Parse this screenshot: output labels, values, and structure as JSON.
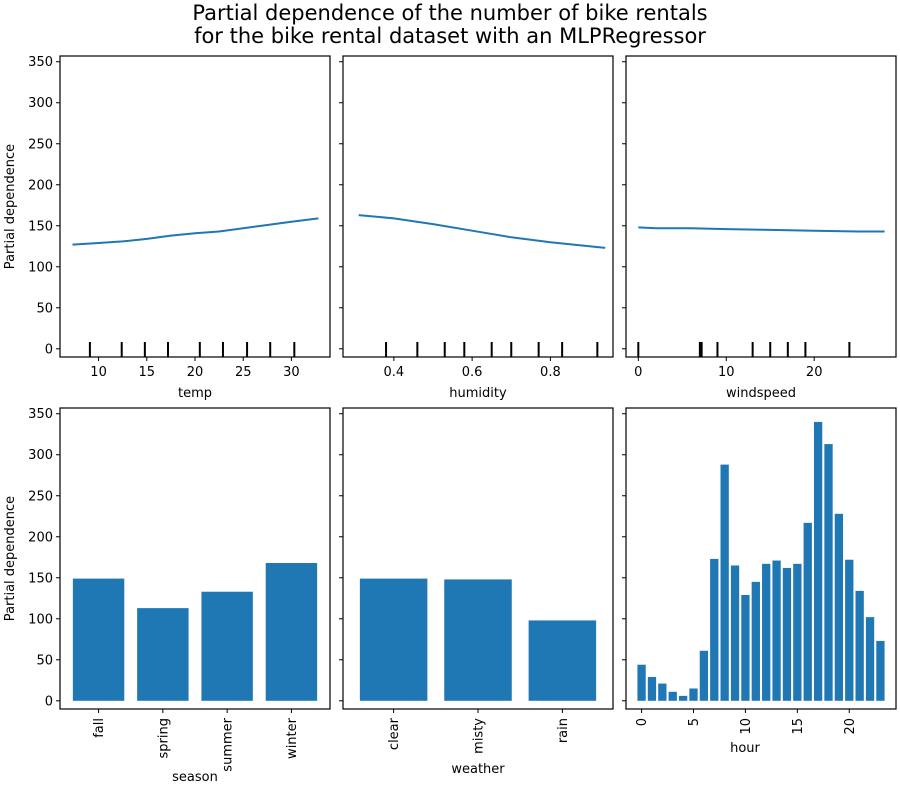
{
  "title_lines": [
    "Partial dependence of the number of bike rentals",
    "for the bike rental dataset with an MLPRegressor"
  ],
  "chart_data": [
    {
      "type": "line",
      "feature": "temp",
      "xlabel": "temp",
      "ylabel": "Partial dependence",
      "xlim": [
        6.0,
        34.0
      ],
      "ylim": [
        -10,
        357
      ],
      "xticks": [
        10,
        15,
        20,
        25,
        30
      ],
      "yticks": [
        0,
        50,
        100,
        150,
        200,
        250,
        300,
        350
      ],
      "x": [
        7.3,
        10,
        12.5,
        15,
        17.5,
        20,
        22.5,
        25,
        27.5,
        30,
        32.8
      ],
      "y": [
        127,
        129,
        131,
        134,
        138,
        141,
        143,
        147,
        151,
        155,
        159
      ],
      "deciles": [
        9.1,
        12.4,
        14.8,
        17.2,
        20.5,
        22.9,
        25.4,
        27.8,
        30.3
      ],
      "color": "#1f77b4"
    },
    {
      "type": "line",
      "feature": "humidity",
      "xlabel": "humidity",
      "ylabel": "",
      "xlim": [
        0.27,
        0.96
      ],
      "ylim": [
        -10,
        357
      ],
      "xticks": [
        0.4,
        0.6,
        0.8
      ],
      "yticks": [
        0,
        50,
        100,
        150,
        200,
        250,
        300,
        350
      ],
      "x": [
        0.31,
        0.4,
        0.5,
        0.6,
        0.7,
        0.8,
        0.94
      ],
      "y": [
        163,
        159,
        152,
        144,
        136,
        130,
        123
      ],
      "deciles": [
        0.38,
        0.46,
        0.53,
        0.58,
        0.65,
        0.7,
        0.77,
        0.83,
        0.92
      ],
      "color": "#1f77b4"
    },
    {
      "type": "line",
      "feature": "windspeed",
      "xlabel": "windspeed",
      "ylabel": "",
      "xlim": [
        -1.4,
        29.3
      ],
      "ylim": [
        -10,
        357
      ],
      "xticks": [
        0,
        10,
        20
      ],
      "yticks": [
        0,
        50,
        100,
        150,
        200,
        250,
        300,
        350
      ],
      "x": [
        0,
        2,
        6,
        10,
        15,
        20,
        25,
        28
      ],
      "y": [
        148,
        147,
        147,
        146,
        145,
        144,
        143,
        143
      ],
      "deciles": [
        0,
        7,
        7.2,
        9,
        13,
        15,
        17,
        19,
        24
      ],
      "color": "#1f77b4"
    },
    {
      "type": "bar",
      "feature": "season",
      "xlabel": "season",
      "ylabel": "Partial dependence",
      "categories": [
        "fall",
        "spring",
        "summer",
        "winter"
      ],
      "values": [
        149,
        113,
        133,
        168
      ],
      "ylim": [
        -10,
        357
      ],
      "yticks": [
        0,
        50,
        100,
        150,
        200,
        250,
        300,
        350
      ],
      "color": "#1f77b4"
    },
    {
      "type": "bar",
      "feature": "weather",
      "xlabel": "weather",
      "ylabel": "",
      "categories": [
        "clear",
        "misty",
        "rain"
      ],
      "values": [
        149,
        148,
        98
      ],
      "ylim": [
        -10,
        357
      ],
      "yticks": [
        0,
        50,
        100,
        150,
        200,
        250,
        300,
        350
      ],
      "color": "#1f77b4"
    },
    {
      "type": "bar",
      "feature": "hour",
      "xlabel": "hour",
      "ylabel": "",
      "categories": [
        0,
        1,
        2,
        3,
        4,
        5,
        6,
        7,
        8,
        9,
        10,
        11,
        12,
        13,
        14,
        15,
        16,
        17,
        18,
        19,
        20,
        21,
        22,
        23
      ],
      "values": [
        44,
        29,
        21,
        11,
        6,
        15,
        61,
        173,
        288,
        165,
        129,
        145,
        167,
        171,
        162,
        167,
        217,
        340,
        313,
        228,
        172,
        134,
        102,
        73
      ],
      "xticks": [
        0,
        5,
        10,
        15,
        20
      ],
      "xlim": [
        -1.5,
        24.5
      ],
      "ylim": [
        -10,
        357
      ],
      "yticks": [
        0,
        50,
        100,
        150,
        200,
        250,
        300,
        350
      ],
      "color": "#1f77b4"
    }
  ]
}
